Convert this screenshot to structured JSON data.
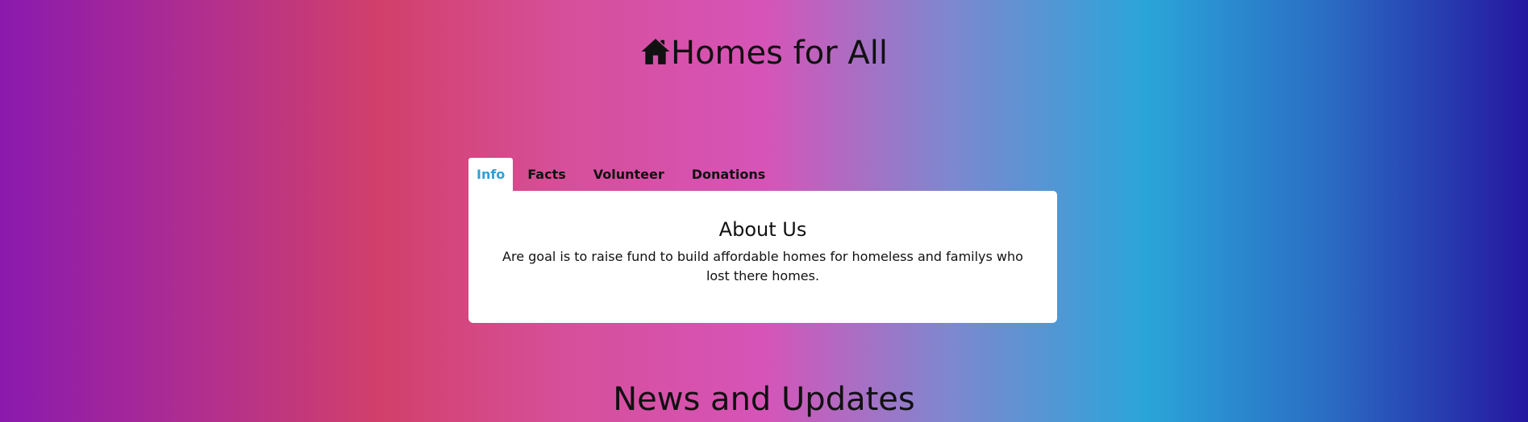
{
  "header": {
    "icon": "home-icon",
    "title": "Homes for All"
  },
  "tabs": [
    {
      "label": "Info",
      "active": true
    },
    {
      "label": "Facts",
      "active": false
    },
    {
      "label": "Volunteer",
      "active": false
    },
    {
      "label": "Donations",
      "active": false
    }
  ],
  "panel": {
    "heading": "About Us",
    "body": "Are goal is to raise fund to build affordable homes for homeless and familys who lost there homes."
  },
  "news": {
    "heading": "News and Updates"
  },
  "colors": {
    "active_tab": "#2d9fd6"
  }
}
